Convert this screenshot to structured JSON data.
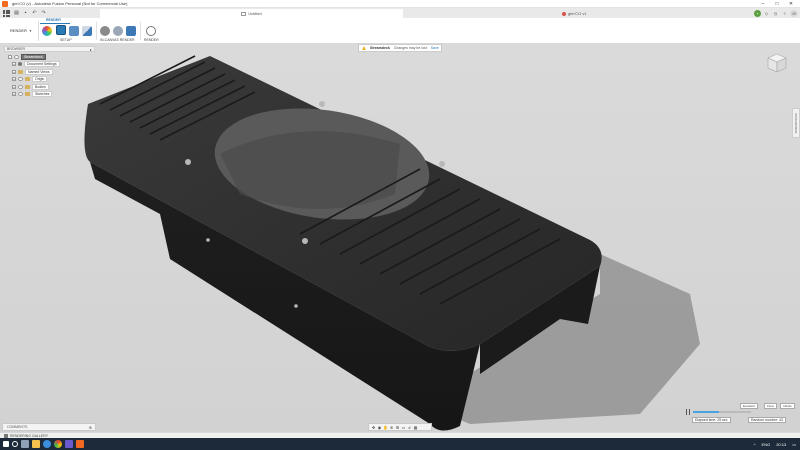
{
  "window": {
    "title": "gim'CO (v) - Autodesk Fusion Personal (Not for Commercial Use)",
    "controls": [
      "–",
      "□",
      "✕"
    ]
  },
  "tabs": {
    "center_tab": "Untitled",
    "right_tab": "gim'CO v1"
  },
  "ribbon": {
    "workspace": "RENDER",
    "active_tab": "RENDER",
    "groups": {
      "setup": "SETUP",
      "in_canvas": "IN-CANVAS RENDER",
      "render": "RENDER"
    }
  },
  "browser": {
    "header": "BROWSER",
    "root": "Streamdeck",
    "items": [
      {
        "label": "Document Settings",
        "icon": "gear-icon"
      },
      {
        "label": "Named Views",
        "icon": "folder-icon"
      },
      {
        "label": "Origin",
        "icon": "folder-icon"
      },
      {
        "label": "Bodies",
        "icon": "folder-icon"
      },
      {
        "label": "Sketches",
        "icon": "folder-icon"
      }
    ]
  },
  "notification": {
    "name": "Streamdeck",
    "message": "Changes may be lost",
    "action": "Save"
  },
  "side_tab": "APPEARANCE",
  "render_progress": {
    "mode_quality": "Excellent",
    "mode_final": "Final",
    "mode_infinite": "Infinite",
    "elapsed": "Elapsed time: 25 sec",
    "random_number": "Random number: 43",
    "progress_fraction": 0.45
  },
  "comments": {
    "label": "COMMENTS",
    "add": "⊕"
  },
  "statusbar": {
    "label": "RENDERING GALLERY"
  },
  "taskbar": {
    "lang": "ENG",
    "time": "20:13"
  },
  "colors": {
    "accent": "#2a7ab5",
    "model": "#2e2e2e",
    "shadow": "#7a7a7a",
    "taskbar": "#1c2a3a"
  }
}
